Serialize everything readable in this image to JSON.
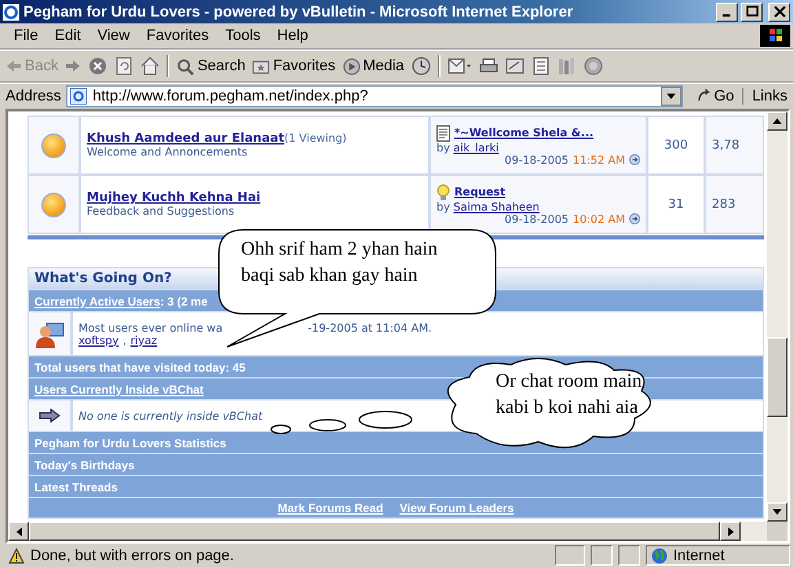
{
  "window": {
    "title": "Pegham for Urdu Lovers - powered by vBulletin - Microsoft Internet Explorer"
  },
  "menu": [
    "File",
    "Edit",
    "View",
    "Favorites",
    "Tools",
    "Help"
  ],
  "toolbar": {
    "back": "Back",
    "search": "Search",
    "favorites": "Favorites",
    "media": "Media"
  },
  "address": {
    "label": "Address",
    "url": "http://www.forum.pegham.net/index.php?",
    "go": "Go",
    "links": "Links"
  },
  "forums": [
    {
      "title": "Khush Aamdeed aur Elanaat",
      "viewing": "(1 Viewing)",
      "description": "Welcome and Annoncements",
      "last_post": {
        "kind": "note",
        "title": "*~Wellcome Shela &...",
        "by": "by",
        "author": "aik_larki",
        "date": "09-18-2005",
        "time": "11:52 AM"
      },
      "threads": "300",
      "posts": "3,78"
    },
    {
      "title": "Mujhey Kuchh Kehna Hai",
      "description": "Feedback and Suggestions",
      "last_post": {
        "kind": "idea",
        "title": "Request",
        "by": "by",
        "author": "Saima Shaheen",
        "date": "09-18-2005",
        "time": "10:02 AM"
      },
      "threads": "31",
      "posts": "283"
    }
  ],
  "going_on": {
    "title": "What's Going On?",
    "active_users": {
      "label": "Currently Active Users",
      "text": ": 3 (2 me"
    },
    "record": {
      "text": "Most users ever online wa",
      "date": "-19-2005 at 11:04 AM.",
      "users": [
        "xoftspy",
        "riyaz"
      ],
      "separator": ","
    },
    "visitors": "Total users that have visited today: 45",
    "chat": {
      "label": "Users Currently Inside vBChat",
      "message": "No one is currently inside vBChat"
    },
    "sections": [
      "Pegham for Urdu Lovers Statistics",
      "Today's Birthdays",
      "Latest Threads"
    ],
    "footer_links": [
      "Mark Forums Read",
      "View Forum Leaders"
    ]
  },
  "bubbles": [
    {
      "kind": "speech",
      "lines": [
        "Ohh srif ham 2 yhan hain",
        "baqi sab khan gay hain"
      ]
    },
    {
      "kind": "thought",
      "lines": [
        "Or chat room main",
        "kabi b koi nahi aia"
      ]
    }
  ],
  "status_bar": {
    "message": "Done, but with errors on page.",
    "zone": "Internet"
  }
}
